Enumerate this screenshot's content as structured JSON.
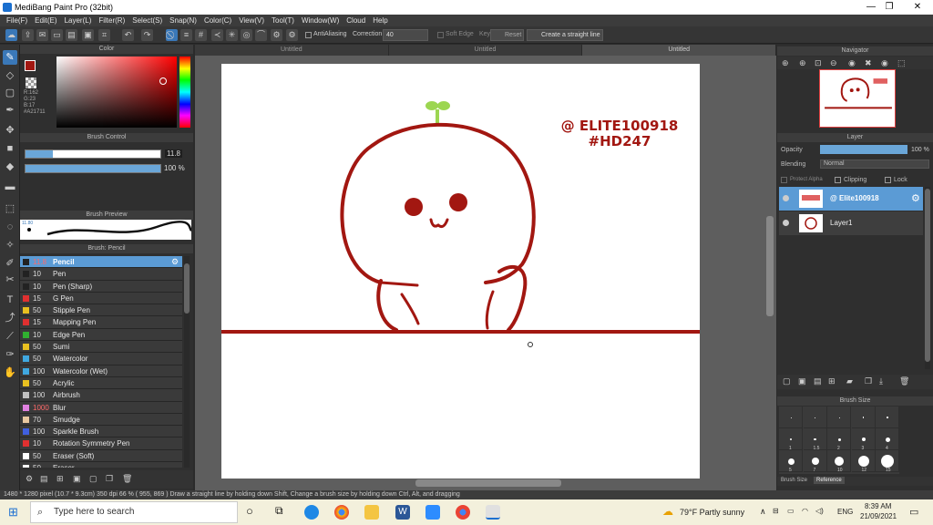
{
  "window": {
    "title": "MediBang Paint Pro (32bit)",
    "min": "—",
    "max": "❐",
    "close": "✕"
  },
  "menu": [
    "File(F)",
    "Edit(E)",
    "Layer(L)",
    "Filter(R)",
    "Select(S)",
    "Snap(N)",
    "Color(C)",
    "View(V)",
    "Tool(T)",
    "Window(W)",
    "Cloud",
    "Help"
  ],
  "toolbar": {
    "antialiasing": "AntiAliasing",
    "correction_label": "Correction",
    "correction_value": "40",
    "soft_edge": "Soft Edge",
    "key": "Key",
    "reset": "Reset",
    "straight_line": "Create a straight line"
  },
  "tabs": [
    "Untitled",
    "Untitled",
    "Untitled"
  ],
  "color_panel": {
    "title": "Color",
    "r": "R:162",
    "g": "G:23",
    "b": "B:17",
    "hex": "#A21711",
    "fg": "#a21711"
  },
  "brush_control": {
    "title": "Brush Control",
    "size": "11.8",
    "opacity": "100 %",
    "size_fill": 0.2,
    "opacity_fill": 1.0
  },
  "brush_preview": {
    "title": "Brush Preview",
    "size": "11.80"
  },
  "brush_list": {
    "title": "Brush: Pencil",
    "items": [
      {
        "size": "11.8",
        "name": "Pencil",
        "color": "#222222",
        "selected": true
      },
      {
        "size": "10",
        "name": "Pen",
        "color": "#222222"
      },
      {
        "size": "10",
        "name": "Pen (Sharp)",
        "color": "#222222"
      },
      {
        "size": "15",
        "name": "G Pen",
        "color": "#e03030"
      },
      {
        "size": "50",
        "name": "Stipple Pen",
        "color": "#e8c020"
      },
      {
        "size": "15",
        "name": "Mapping Pen",
        "color": "#e03030"
      },
      {
        "size": "10",
        "name": "Edge Pen",
        "color": "#30b030"
      },
      {
        "size": "50",
        "name": "Sumi",
        "color": "#e8c020"
      },
      {
        "size": "50",
        "name": "Watercolor",
        "color": "#40a8e0"
      },
      {
        "size": "100",
        "name": "Watercolor (Wet)",
        "color": "#40a8e0"
      },
      {
        "size": "50",
        "name": "Acrylic",
        "color": "#e8c020"
      },
      {
        "size": "100",
        "name": "Airbrush",
        "color": "#c0c0c0"
      },
      {
        "size": "1000",
        "name": "Blur",
        "color": "#e080e0",
        "red": true
      },
      {
        "size": "70",
        "name": "Smudge",
        "color": "#e8c8a0"
      },
      {
        "size": "100",
        "name": "Sparkle Brush",
        "color": "#4060e0"
      },
      {
        "size": "10",
        "name": "Rotation Symmetry Pen",
        "color": "#e03030"
      },
      {
        "size": "50",
        "name": "Eraser (Soft)",
        "color": "#ffffff"
      },
      {
        "size": "50",
        "name": "Eraser",
        "color": "#ffffff"
      }
    ]
  },
  "artwork": {
    "watermark_line1": "@ ELITE100918",
    "watermark_line2": "#HD247",
    "ink": "#a21711",
    "sprout": "#9cd651"
  },
  "navigator": {
    "title": "Navigator"
  },
  "layer_panel": {
    "title": "Layer",
    "opacity_label": "Opacity",
    "opacity_value": "100 %",
    "blending_label": "Blending",
    "blending_value": "Normal",
    "protect_alpha": "Protect Alpha",
    "clipping": "Clipping",
    "lock": "Lock",
    "layers": [
      {
        "name": "@ Elite100918",
        "selected": true
      },
      {
        "name": "Layer1",
        "selected": false
      }
    ]
  },
  "brush_size_panel": {
    "title": "Brush Size",
    "tabs": [
      "Brush Size",
      "Reference"
    ],
    "labels": [
      "1",
      "1.5",
      "2",
      "3",
      "4",
      "5",
      "7",
      "10",
      "12",
      "15"
    ]
  },
  "status": "1480 * 1280 pixel  (10.7 * 9.3cm)  350 dpi   66 %  ( 955, 869 )  Draw a straight line by holding down Shift, Change a brush size by holding down Ctrl, Alt, and dragging",
  "taskbar": {
    "search_placeholder": "Type here to search",
    "weather": "79°F  Partly sunny",
    "lang": "ENG",
    "time": "8:39 AM",
    "date": "21/09/2021"
  }
}
